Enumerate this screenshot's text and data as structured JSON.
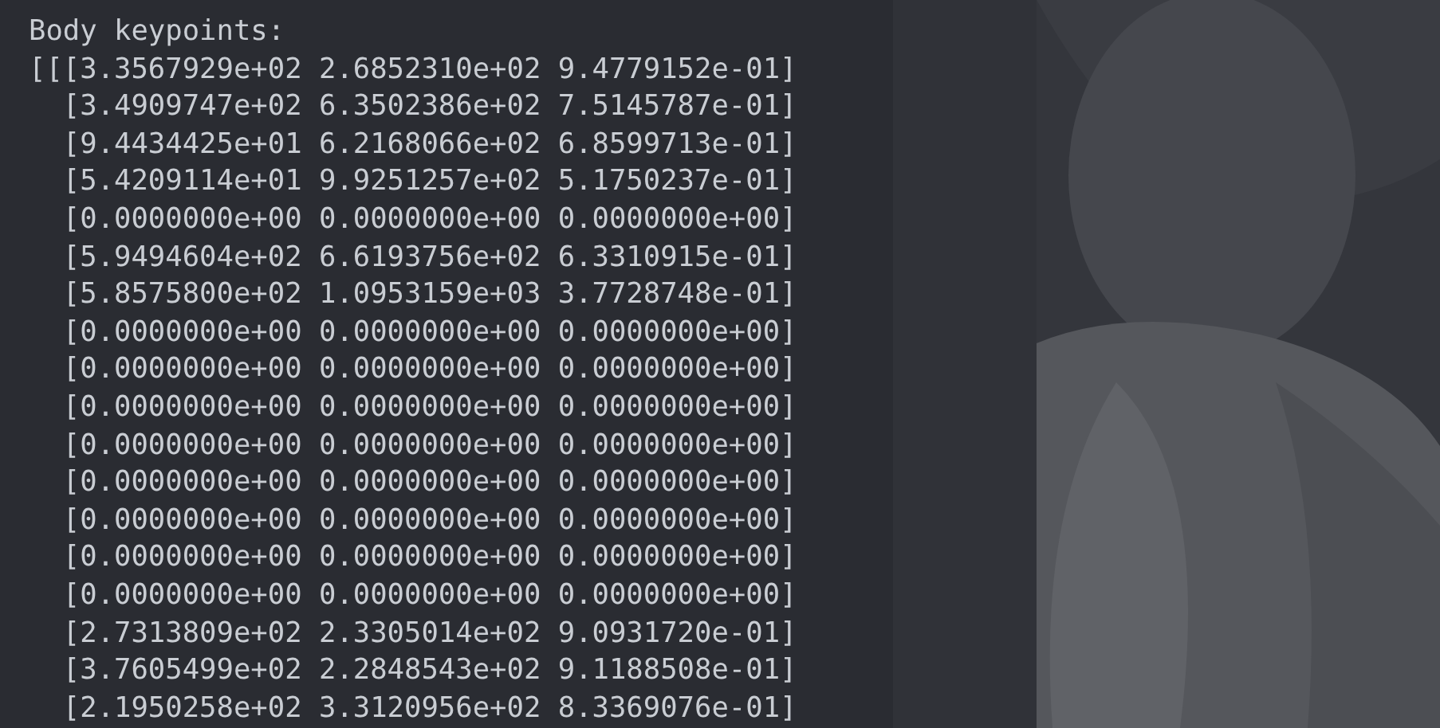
{
  "terminal": {
    "header": "Body keypoints:",
    "rows": [
      "[[[3.3567929e+02 2.6852310e+02 9.4779152e-01]",
      "[3.4909747e+02 6.3502386e+02 7.5145787e-01]",
      "[9.4434425e+01 6.2168066e+02 6.8599713e-01]",
      "[5.4209114e+01 9.9251257e+02 5.1750237e-01]",
      "[0.0000000e+00 0.0000000e+00 0.0000000e+00]",
      "[5.9494604e+02 6.6193756e+02 6.3310915e-01]",
      "[5.8575800e+02 1.0953159e+03 3.7728748e-01]",
      "[0.0000000e+00 0.0000000e+00 0.0000000e+00]",
      "[0.0000000e+00 0.0000000e+00 0.0000000e+00]",
      "[0.0000000e+00 0.0000000e+00 0.0000000e+00]",
      "[0.0000000e+00 0.0000000e+00 0.0000000e+00]",
      "[0.0000000e+00 0.0000000e+00 0.0000000e+00]",
      "[0.0000000e+00 0.0000000e+00 0.0000000e+00]",
      "[0.0000000e+00 0.0000000e+00 0.0000000e+00]",
      "[0.0000000e+00 0.0000000e+00 0.0000000e+00]",
      "[2.7313809e+02 2.3305014e+02 9.0931720e-01]",
      "[3.7605499e+02 2.2848543e+02 9.1188508e-01]",
      "[2.1950258e+02 3.3120956e+02 8.3369076e-01]"
    ]
  }
}
